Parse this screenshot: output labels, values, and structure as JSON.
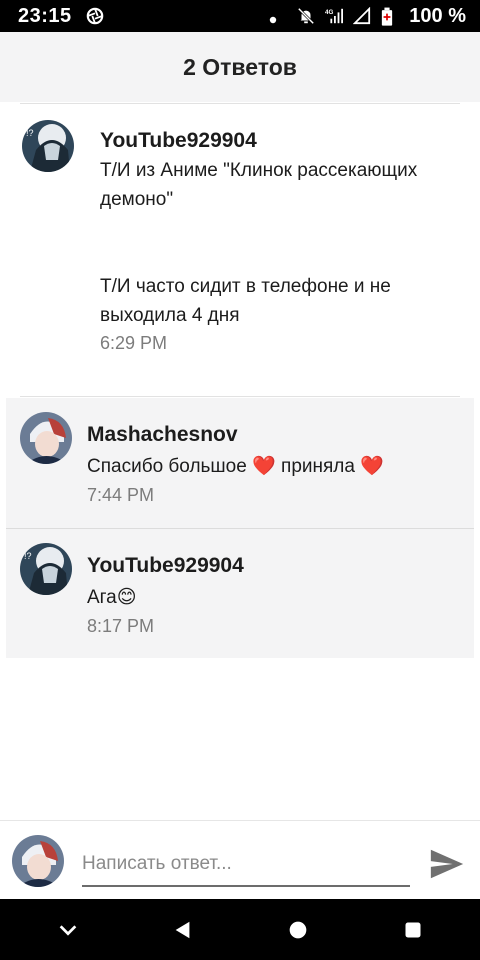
{
  "status_bar": {
    "time": "23:15",
    "battery": "100 %",
    "network": "4G"
  },
  "header": {
    "title": "2 Ответов"
  },
  "main_comment": {
    "author": "YouTube929904",
    "text": "Т/И из Аниме \"Клинок рассекающих демоно\"\n\n\nТ/И часто сидит в телефоне и не выходила 4 дня",
    "time": "6:29 PM"
  },
  "replies": [
    {
      "author": "Mashachesnov",
      "text": "Спасибо большое ❤️ приняла ❤️",
      "time": "7:44 PM"
    },
    {
      "author": "YouTube929904",
      "text": "Ага😊",
      "time": "8:17 PM"
    }
  ],
  "reply_box": {
    "placeholder": "Написать ответ..."
  },
  "icons": {
    "send": "send-icon",
    "back": "back-triangle-icon",
    "home": "home-circle-icon",
    "recents": "recents-square-icon",
    "collapse": "chevron-down-icon"
  },
  "colors": {
    "reply_background": "#f4f4f5",
    "timestamp": "#7c7c7c"
  }
}
